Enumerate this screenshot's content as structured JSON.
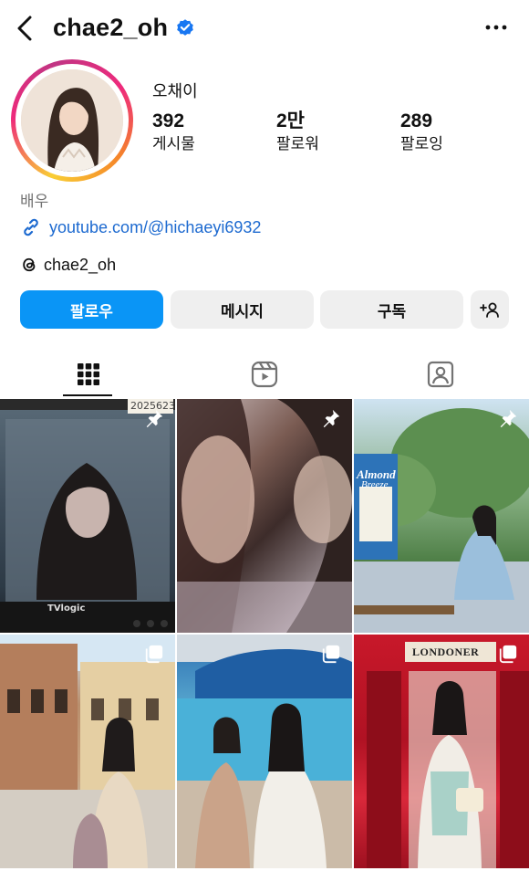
{
  "header": {
    "username": "chae2_oh",
    "verified": true
  },
  "profile": {
    "display_name": "오채이",
    "stats": [
      {
        "value": "392",
        "label": "게시물"
      },
      {
        "value": "2만",
        "label": "팔로워"
      },
      {
        "value": "289",
        "label": "팔로잉"
      }
    ],
    "category": "배우",
    "link": "youtube.com/@hichaeyi6932",
    "threads_handle": "chae2_oh"
  },
  "actions": {
    "follow": "팔로우",
    "message": "메시지",
    "subscribe": "구독"
  },
  "grid_texts": {
    "post1_stamp": "2025623",
    "post1_monitor": "TVlogic",
    "post3_product_brand": "Almond",
    "post3_product_line": "Breeze",
    "post6_sign": "LONDONER"
  },
  "colors": {
    "follow_blue": "#0a95f6",
    "link_blue": "#1d6ad0",
    "verified_blue": "#1877f2",
    "button_gray": "#efefef"
  },
  "icons": {
    "back": "chevron-left-icon",
    "more": "more-horizontal-icon",
    "link": "link-icon",
    "threads": "threads-icon",
    "add_person": "add-person-icon",
    "tab_grid": "grid-icon",
    "tab_reels": "reels-icon",
    "tab_tagged": "tagged-icon",
    "pinned": "pin-icon",
    "carousel": "carousel-icon"
  }
}
